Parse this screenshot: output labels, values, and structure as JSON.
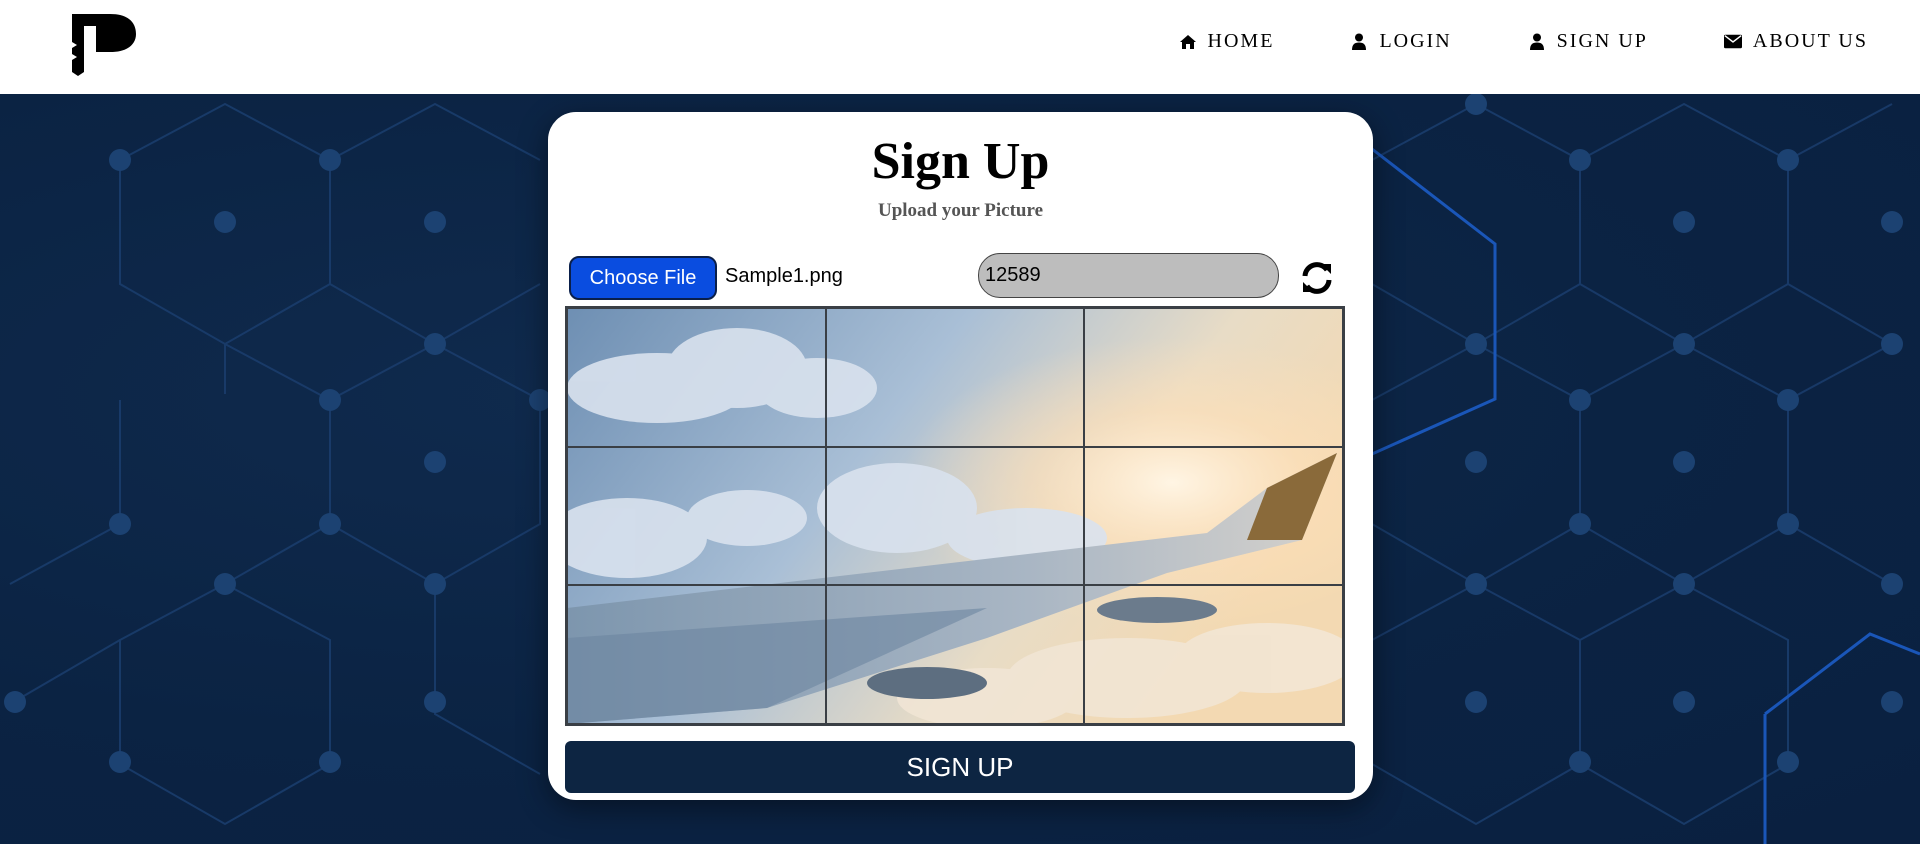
{
  "header": {
    "logo_alt": "P",
    "nav": [
      {
        "label": "HOME",
        "icon": "home-icon"
      },
      {
        "label": "LOGIN",
        "icon": "user-icon"
      },
      {
        "label": "SIGN UP",
        "icon": "user-icon"
      },
      {
        "label": "ABOUT US",
        "icon": "envelope-icon"
      }
    ]
  },
  "card": {
    "title": "Sign Up",
    "subtitle": "Upload your Picture",
    "choose_file_label": "Choose File",
    "file_name": "Sample1.png",
    "code_value": "12589",
    "signup_label": "SIGN UP"
  },
  "image_grid": {
    "rows": 3,
    "cols": 3,
    "subject": "airplane wing above clouds at sunset"
  },
  "colors": {
    "background": "#0b2545",
    "accent": "#0a4de0",
    "button_dark": "#0d2542"
  }
}
